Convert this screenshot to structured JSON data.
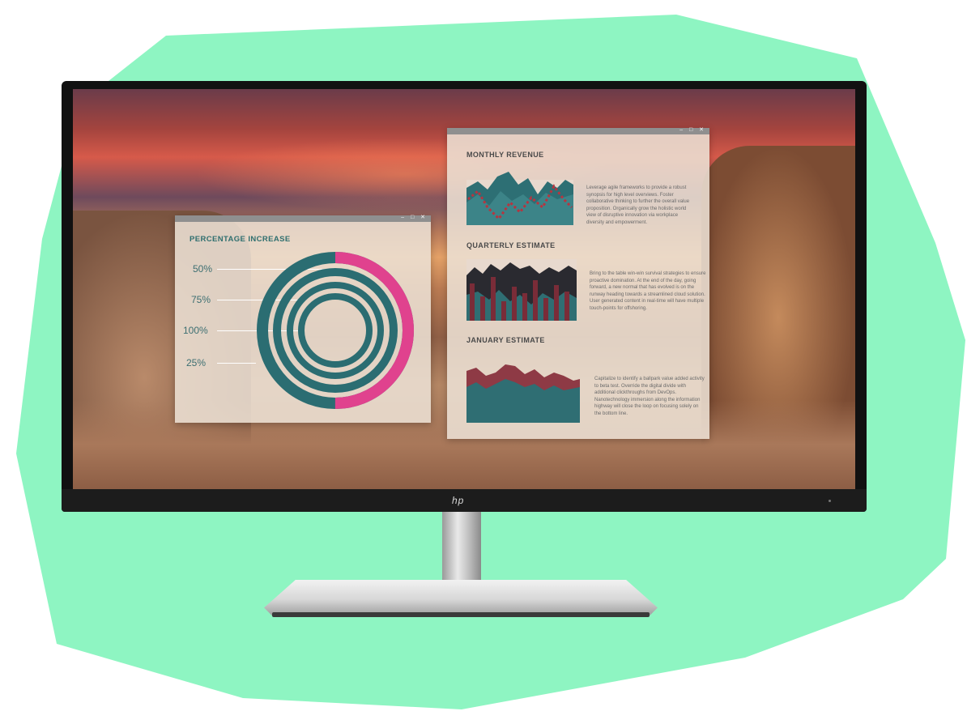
{
  "colors": {
    "background_blob": "#8ef5c2",
    "teal": "#2b6d72",
    "pink": "#e0428e",
    "dark_red": "#7a2c38"
  },
  "monitor": {
    "brand_logo": "hp"
  },
  "window_controls": {
    "minimize": "–",
    "maximize": "□",
    "close": "✕"
  },
  "percentage_window": {
    "title": "PERCENTAGE INCREASE",
    "rings": [
      {
        "label": "50%",
        "value": 50
      },
      {
        "label": "75%",
        "value": 75
      },
      {
        "label": "100%",
        "value": 100
      },
      {
        "label": "25%",
        "value": 25
      }
    ]
  },
  "revenue_window": {
    "sections": [
      {
        "title": "MONTHLY REVENUE",
        "text": "Leverage agile frameworks to provide a robust synopsis for high level overviews. Foster collaborative thinking to further the overall value proposition. Organically grow the holistic world view of disruptive innovation via workplace diversity and empowerment."
      },
      {
        "title": "QUARTERLY ESTIMATE",
        "text": "Bring to the table win-win survival strategies to ensure proactive domination. At the end of the day, going forward, a new normal that has evolved is on the runway heading towards a streamlined cloud solution. User generated content in real-time will have multiple touch-points for offshoring."
      },
      {
        "title": "JANUARY ESTIMATE",
        "text": "Capitalize to identify a ballpark value added activity to beta test. Override the digital divide with additional clickthroughs from DevOps. Nanotechnology immersion along the information highway will close the loop on focusing solely on the bottom line."
      }
    ]
  }
}
